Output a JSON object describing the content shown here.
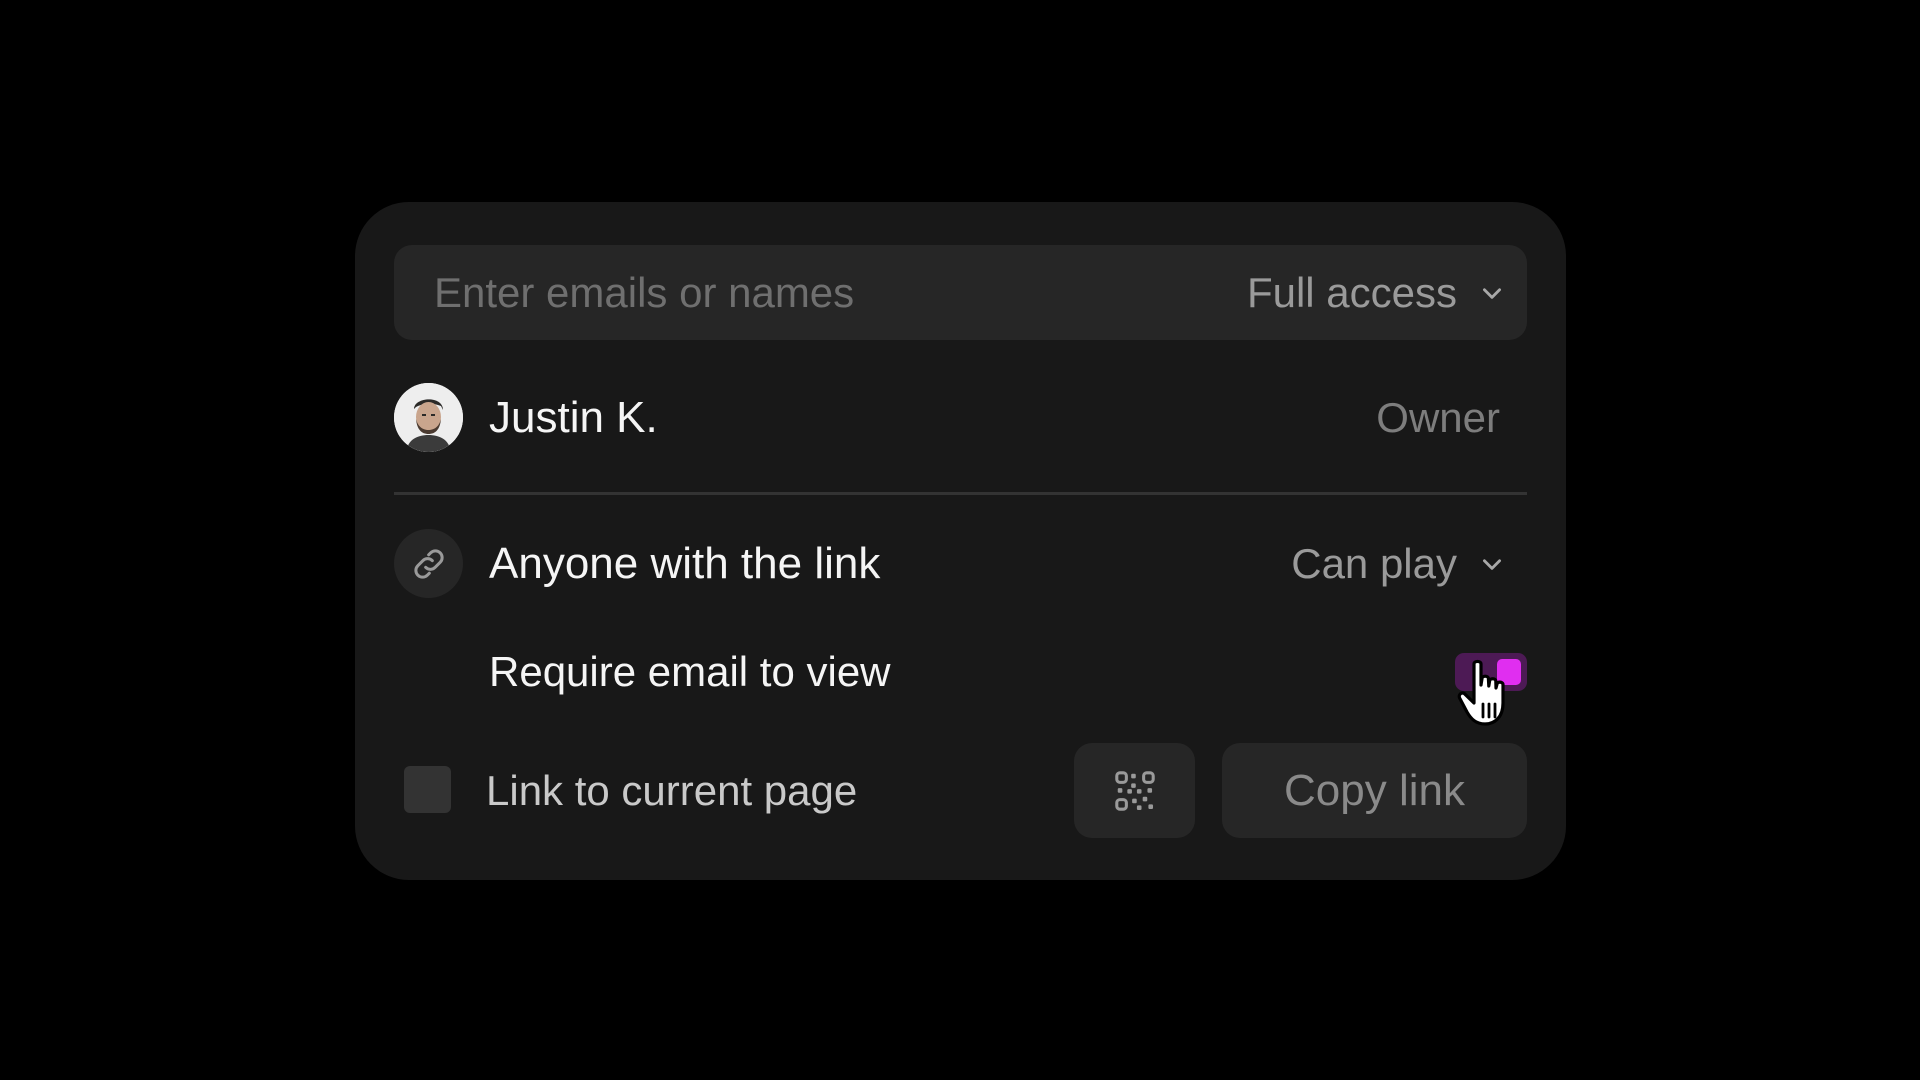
{
  "invite": {
    "placeholder": "Enter emails or names",
    "access_label": "Full access"
  },
  "members": [
    {
      "name": "Justin K.",
      "role": "Owner"
    }
  ],
  "link_sharing": {
    "label": "Anyone with the link",
    "permission": "Can play",
    "require_email_label": "Require email to view",
    "require_email_enabled": true
  },
  "footer": {
    "link_current_page_label": "Link to current page",
    "link_current_page_checked": false,
    "copy_link_label": "Copy link"
  },
  "icons": {
    "avatar": "user-avatar-photo",
    "access_dropdown": "chevron-down-icon",
    "link": "link-icon",
    "permission_dropdown": "chevron-down-icon",
    "qr": "qr-code-icon",
    "cursor": "hand-pointer-icon"
  },
  "colors": {
    "background": "#000000",
    "card": "#181818",
    "control": "#262626",
    "toggle_track": "#4d1a55",
    "toggle_knob": "#e02ef0"
  }
}
